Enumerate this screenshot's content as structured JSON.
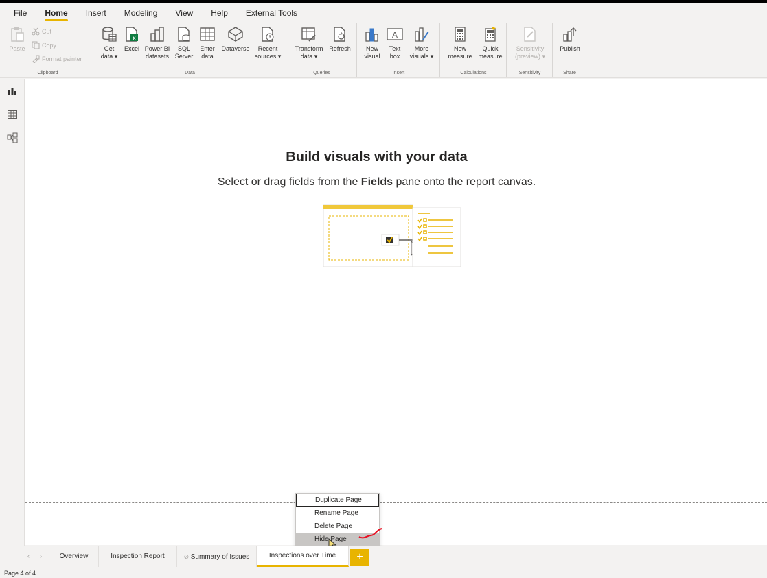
{
  "menu": [
    "File",
    "Home",
    "Insert",
    "Modeling",
    "View",
    "Help",
    "External Tools"
  ],
  "menu_active": "Home",
  "accent": "#e8b400",
  "ribbon": {
    "clipboard": {
      "paste": "Paste",
      "cut": "Cut",
      "copy": "Copy",
      "format_painter": "Format painter",
      "label": "Clipboard"
    },
    "data": {
      "label": "Data",
      "buttons": [
        {
          "l1": "Get",
          "l2": "data ▾"
        },
        {
          "l1": "Excel",
          "l2": ""
        },
        {
          "l1": "Power BI",
          "l2": "datasets"
        },
        {
          "l1": "SQL",
          "l2": "Server"
        },
        {
          "l1": "Enter",
          "l2": "data"
        },
        {
          "l1": "Dataverse",
          "l2": ""
        },
        {
          "l1": "Recent",
          "l2": "sources ▾"
        }
      ]
    },
    "queries": {
      "label": "Queries",
      "buttons": [
        {
          "l1": "Transform",
          "l2": "data ▾"
        },
        {
          "l1": "Refresh",
          "l2": ""
        }
      ]
    },
    "insert": {
      "label": "Insert",
      "buttons": [
        {
          "l1": "New",
          "l2": "visual"
        },
        {
          "l1": "Text",
          "l2": "box"
        },
        {
          "l1": "More",
          "l2": "visuals ▾"
        }
      ]
    },
    "calculations": {
      "label": "Calculations",
      "buttons": [
        {
          "l1": "New",
          "l2": "measure"
        },
        {
          "l1": "Quick",
          "l2": "measure"
        }
      ]
    },
    "sensitivity": {
      "label": "Sensitivity",
      "l1": "Sensitivity",
      "l2": "(preview) ▾"
    },
    "share": {
      "label": "Share",
      "l1": "Publish"
    }
  },
  "canvas": {
    "title": "Build visuals with your data",
    "subtitle_before": "Select or drag fields from the ",
    "subtitle_bold": "Fields",
    "subtitle_after": " pane onto the report canvas."
  },
  "context_menu": [
    "Duplicate Page",
    "Rename Page",
    "Delete Page",
    "Hide Page"
  ],
  "tabs": [
    "Overview",
    "Inspection Report",
    "Summary of Issues",
    "Inspections over Time"
  ],
  "add_tab": "+",
  "status": "Page 4 of 4",
  "annotation_color": "#e81123"
}
